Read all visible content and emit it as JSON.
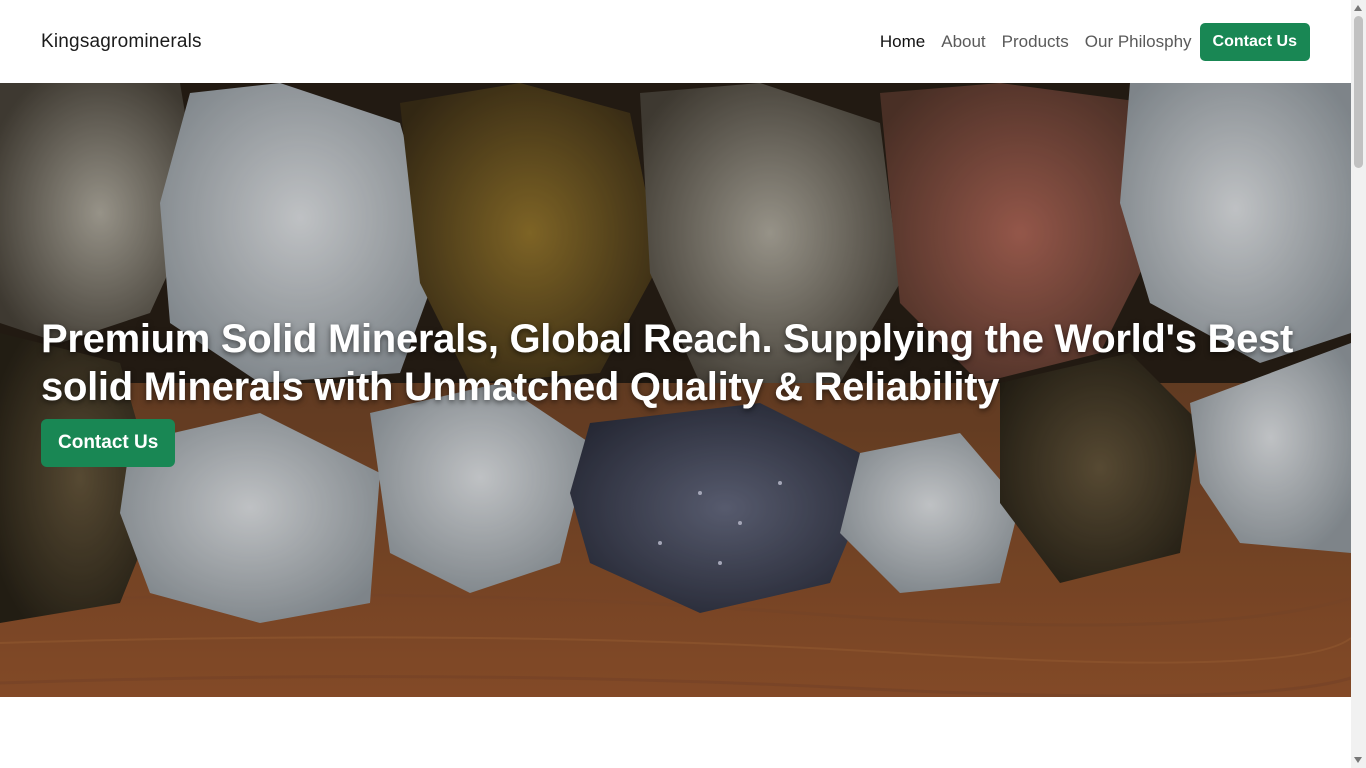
{
  "navbar": {
    "brand": "Kingsagrominerals",
    "links": [
      {
        "label": "Home",
        "active": true
      },
      {
        "label": "About",
        "active": false
      },
      {
        "label": "Products",
        "active": false
      },
      {
        "label": "Our Philosphy",
        "active": false
      }
    ],
    "cta_label": "Contact Us"
  },
  "hero": {
    "title": "Premium Solid Minerals, Global Reach. Supplying the World's Best solid Minerals with Unmatched Quality & Reliability",
    "cta_label": "Contact Us"
  },
  "colors": {
    "accent": "#198754"
  }
}
